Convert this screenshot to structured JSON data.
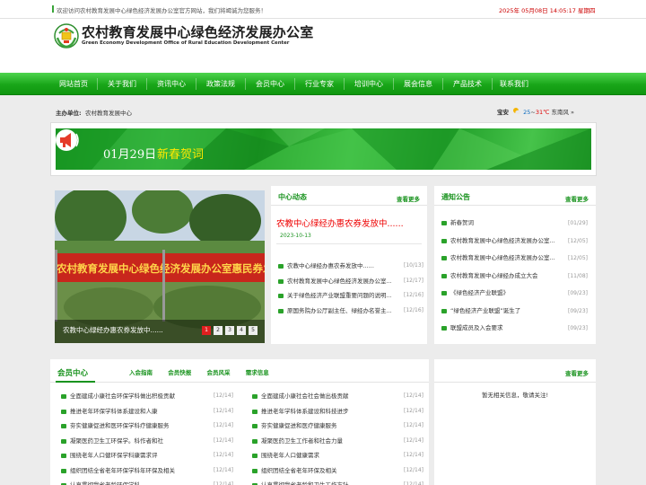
{
  "topbar": {
    "welcome": "欢迎访问农村教育发展中心绿色经济发展办公室官方网站，我们将竭诚为您服务！",
    "date": "2025年 05月08日  14:05:17  星期四"
  },
  "header": {
    "title_cn": "农村教育发展中心绿色经济发展办公室",
    "title_en": "Green Economy Development Office of Rural Education Development Center"
  },
  "nav": [
    "网站首页",
    "关于我们",
    "资讯中心",
    "政策法规",
    "会员中心",
    "行业专家",
    "培训中心",
    "展会信息",
    "产品技术",
    "联系我们"
  ],
  "info": {
    "host_label": "主办单位:",
    "host_name": "农村教育发展中心",
    "weather_city": "宝安",
    "weather_low": "25",
    "weather_sep": "~",
    "weather_high": "31℃",
    "weather_wind": "东南风",
    "weather_arrow": "»"
  },
  "banner": {
    "date": "01月29日",
    "title": "新春贺词"
  },
  "slider": {
    "photo_banner_text": "农村教育发展中心绿色经济发展办公室惠民券发放",
    "caption": "农教中心绿经办惠农券发放中......",
    "pages": [
      "1",
      "2",
      "3",
      "4",
      "5"
    ],
    "active": 0
  },
  "news": {
    "title": "中心动态",
    "more": "查看更多",
    "headline": "农教中心绿经办惠农券发放中......",
    "headline_date": "2023-10-13",
    "items": [
      {
        "text": "农教中心绿经办惠农券发放中......",
        "date": "[10/13]"
      },
      {
        "text": "农村教育发展中心绿色经济发展办公室...",
        "date": "[12/17]"
      },
      {
        "text": "关于绿色经济产业联盟重要问题的说明...",
        "date": "[12/16]"
      },
      {
        "text": "原国务院办公厅副主任、绿经办名誉主...",
        "date": "[12/16]"
      }
    ]
  },
  "notice": {
    "title": "通知公告",
    "more": "查看更多",
    "items": [
      {
        "text": "新春贺词",
        "date": "[01/29]"
      },
      {
        "text": "农村教育发展中心绿色经济发展办公室...",
        "date": "[12/05]"
      },
      {
        "text": "农村教育发展中心绿色经济发展办公室...",
        "date": "[12/05]"
      },
      {
        "text": "农村教育发展中心绿经办成立大会",
        "date": "[11/08]"
      },
      {
        "text": "《绿色经济产业联盟》",
        "date": "[09/23]"
      },
      {
        "text": "“绿色经济产业联盟”诞生了",
        "date": "[09/23]"
      },
      {
        "text": "联盟成员及入会要求",
        "date": "[09/23]"
      }
    ]
  },
  "member": {
    "title": "会员中心",
    "tabs": [
      "入会指南",
      "会员快报",
      "会员风采",
      "需求信息"
    ],
    "col1": [
      {
        "text": "全面建成小康社会环保学科做出积极贡献",
        "date": "[12/14]"
      },
      {
        "text": "推进老年环保学科体系建设和人康",
        "date": "[12/14]"
      },
      {
        "text": "夯实健康促进和医环保学科疗健康服务",
        "date": "[12/14]"
      },
      {
        "text": "凝聚医药卫生工环保学。科作者和社",
        "date": "[12/14]"
      },
      {
        "text": "围绕老年人口健环保学科康需求评",
        "date": "[12/14]"
      },
      {
        "text": "组织团结全省老年环保学科年环保及相关",
        "date": "[12/14]"
      },
      {
        "text": "认真贯彻我省老龄环保学科",
        "date": "[12/14]"
      }
    ],
    "col2": [
      {
        "text": "全面建成小康社会社会做出极贡献",
        "date": "[12/14]"
      },
      {
        "text": "推进老年学科体系建设和科技进步",
        "date": "[12/14]"
      },
      {
        "text": "夯实健康促进和医疗健康服务",
        "date": "[12/14]"
      },
      {
        "text": "凝聚医药卫生工作者和社会力量",
        "date": "[12/14]"
      },
      {
        "text": "围绕老年人口健康需求",
        "date": "[12/14]"
      },
      {
        "text": "组织团结全省老年环保及相关",
        "date": "[12/14]"
      },
      {
        "text": "认真贯彻我省老龄和卫生工作方针",
        "date": "[12/14]"
      }
    ]
  },
  "notice2": {
    "more": "查看更多",
    "empty": "暂无相关信息，敬请关注!"
  },
  "colors": {
    "brand_green": "#19931e",
    "nav_green": "#19a619",
    "headline_red": "#e00000",
    "banner_title_yellow": "#ffe900"
  }
}
